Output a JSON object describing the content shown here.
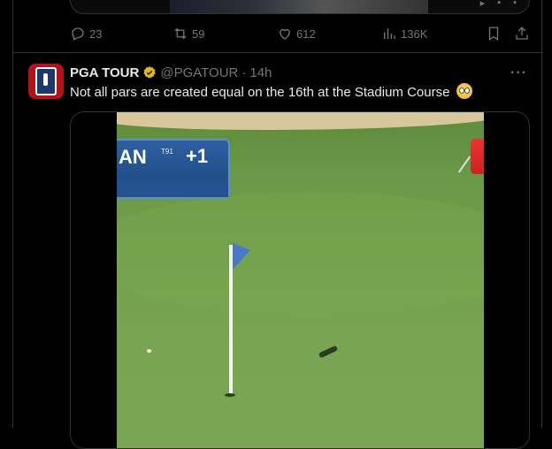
{
  "prev_tweet": {
    "reply_count": "23",
    "retweet_count": "59",
    "like_count": "612",
    "view_count": "136K"
  },
  "tweet": {
    "author_name": "PGA TOUR",
    "handle": "@PGATOUR",
    "separator": "·",
    "time": "14h",
    "more": "···",
    "text": "Not all pars are created equal on the 16th at the Stadium Course"
  },
  "video_overlay": {
    "player_name_partial": "AN",
    "position": "T91",
    "score": "+1"
  },
  "icons": {
    "reply": "reply-icon",
    "retweet": "retweet-icon",
    "like": "heart-icon",
    "views": "views-icon",
    "bookmark": "bookmark-icon",
    "share": "share-icon",
    "verified": "verified-badge-icon",
    "more": "more-icon",
    "emoji": "flushed-face-emoji"
  },
  "colors": {
    "background": "#000000",
    "border": "#2f3336",
    "muted": "#71767b",
    "text": "#e7e9ea",
    "verified_gold": "#e2b719",
    "avatar_red": "#b3121c"
  }
}
